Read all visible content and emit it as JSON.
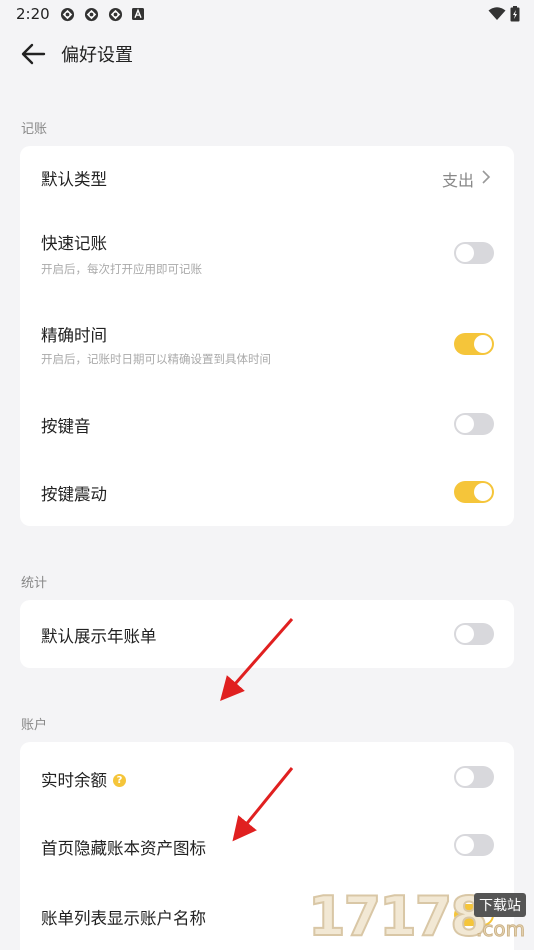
{
  "status_bar": {
    "time": "2:20",
    "left_icons": [
      "app-notification-icon",
      "app-notification-icon",
      "app-notification-icon",
      "a-letter-icon"
    ],
    "right_icons": [
      "wifi-icon",
      "battery-charging-icon"
    ]
  },
  "header": {
    "title": "偏好设置",
    "back_icon": "arrow-left-icon"
  },
  "sections": {
    "bookkeeping": {
      "label": "记账",
      "items": [
        {
          "label": "默认类型",
          "value": "支出",
          "control": "chevron"
        },
        {
          "label": "快速记账",
          "subtitle": "开启后，每次打开应用即可记账",
          "control": "toggle",
          "on": false
        },
        {
          "label": "精确时间",
          "subtitle": "开启后，记账时日期可以精确设置到具体时间",
          "control": "toggle",
          "on": true
        },
        {
          "label": "按键音",
          "control": "toggle",
          "on": false
        },
        {
          "label": "按键震动",
          "control": "toggle",
          "on": true
        }
      ]
    },
    "statistics": {
      "label": "统计",
      "items": [
        {
          "label": "默认展示年账单",
          "control": "toggle",
          "on": false
        }
      ]
    },
    "account": {
      "label": "账户",
      "items": [
        {
          "label": "实时余额",
          "help_icon": "question-icon",
          "help_glyph": "?",
          "control": "toggle",
          "on": false
        },
        {
          "label": "首页隐藏账本资产图标",
          "control": "toggle",
          "on": false
        },
        {
          "label": "账单列表显示账户名称",
          "control": "toggle",
          "on": true
        }
      ]
    }
  },
  "watermark": {
    "digits": "17178",
    "tag": "下载站",
    "domain": ".com"
  },
  "colors": {
    "background": "#f4f4f6",
    "card": "#ffffff",
    "accent": "#f5c53a",
    "toggle_off": "#d8d8dc",
    "annotation_arrow": "#e02020"
  }
}
